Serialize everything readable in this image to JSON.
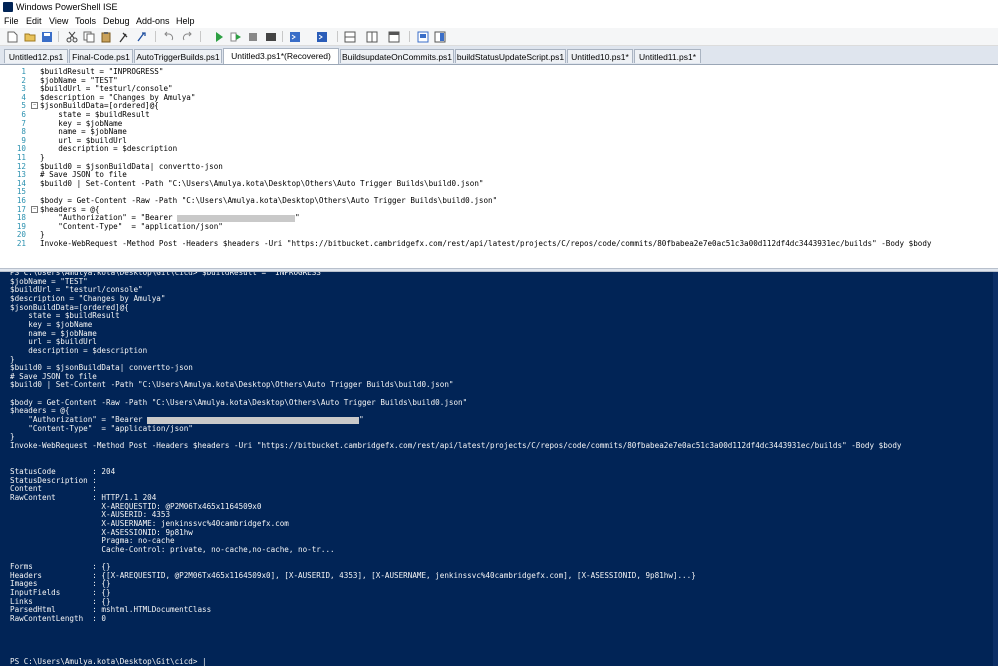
{
  "window": {
    "title": "Windows PowerShell ISE"
  },
  "menu": [
    "File",
    "Edit",
    "View",
    "Tools",
    "Debug",
    "Add-ons",
    "Help"
  ],
  "toolbar": {
    "icons": [
      "new-file-icon",
      "open-icon",
      "save-icon",
      "cut-icon",
      "copy-icon",
      "paste-icon",
      "clear-icon",
      "undo-icon",
      "redo-icon",
      "run-icon",
      "run-selection-icon",
      "stop-icon",
      "new-remote-tab-icon",
      "start-powershell-icon",
      "show-script-pane-top-icon",
      "show-script-pane-right-icon",
      "show-script-pane-maximized-icon",
      "show-command-window-icon",
      "show-command-addon-icon"
    ]
  },
  "tabs": [
    "Untitled12.ps1",
    "Final-Code.ps1",
    "AutoTriggerBuilds.ps1",
    "Untitled3.ps1*(Recovered)",
    "BuildsupdateOnCommits.ps1",
    "buildStatusUpdateScript.ps1",
    "Untitled10.ps1*",
    "Untitled11.ps1*"
  ],
  "active_tab": "Untitled3.ps1*(Recovered)",
  "editor": {
    "lines": [
      {
        "n": "1",
        "text": "$buildResult = \"INPROGRESS\""
      },
      {
        "n": "2",
        "text": "$jobName = \"TEST\""
      },
      {
        "n": "3",
        "text": "$buildUrl = \"testurl/console\""
      },
      {
        "n": "4",
        "text": "$description = \"Changes by Amulya\""
      },
      {
        "n": "5",
        "text": "$jsonBuildData=[ordered]@{"
      },
      {
        "n": "6",
        "text": "    state = $buildResult"
      },
      {
        "n": "7",
        "text": "    key = $jobName"
      },
      {
        "n": "8",
        "text": "    name = $jobName"
      },
      {
        "n": "9",
        "text": "    url = $buildUrl"
      },
      {
        "n": "10",
        "text": "    description = $description"
      },
      {
        "n": "11",
        "text": "}"
      },
      {
        "n": "12",
        "text": "$build0 = $jsonBuildData| convertto-json"
      },
      {
        "n": "13",
        "text": "# Save JSON to file"
      },
      {
        "n": "14",
        "text": "$build0 | Set-Content -Path \"C:\\Users\\Amulya.kota\\Desktop\\Others\\Auto Trigger Builds\\build0.json\""
      },
      {
        "n": "15",
        "text": ""
      },
      {
        "n": "16",
        "text": "$body = Get-Content -Raw -Path \"C:\\Users\\Amulya.kota\\Desktop\\Others\\Auto Trigger Builds\\build0.json\""
      },
      {
        "n": "17",
        "text": "$headers = @{"
      },
      {
        "n": "18",
        "text": "    \"Authorization\" = \"Bearer ",
        "redact": true,
        "tail": "\""
      },
      {
        "n": "19",
        "text": "    \"Content-Type\"  = \"application/json\""
      },
      {
        "n": "20",
        "text": "}"
      },
      {
        "n": "21",
        "text": "Invoke-WebRequest -Method Post -Headers $headers -Uri \"https://bitbucket.cambridgefx.com/rest/api/latest/projects/C/repos/code/commits/80fbabea2e7e0ac51c3a00d112df4dc3443931ec/builds\" -Body $body"
      }
    ]
  },
  "console": {
    "lines": [
      {
        "text": "PS C:\\Users\\Amulya.kota\\Desktop\\Git\\cicd> $buildResult = \"INPROGRESS\""
      },
      {
        "text": "$jobName = \"TEST\""
      },
      {
        "text": "$buildUrl = \"testurl/console\""
      },
      {
        "text": "$description = \"Changes by Amulya\""
      },
      {
        "text": "$jsonBuildData=[ordered]@{"
      },
      {
        "text": "    state = $buildResult"
      },
      {
        "text": "    key = $jobName"
      },
      {
        "text": "    name = $jobName"
      },
      {
        "text": "    url = $buildUrl"
      },
      {
        "text": "    description = $description"
      },
      {
        "text": "}"
      },
      {
        "text": "$build0 = $jsonBuildData| convertto-json"
      },
      {
        "text": "# Save JSON to file"
      },
      {
        "text": "$build0 | Set-Content -Path \"C:\\Users\\Amulya.kota\\Desktop\\Others\\Auto Trigger Builds\\build0.json\""
      },
      {
        "text": ""
      },
      {
        "text": "$body = Get-Content -Raw -Path \"C:\\Users\\Amulya.kota\\Desktop\\Others\\Auto Trigger Builds\\build0.json\""
      },
      {
        "text": "$headers = @{"
      },
      {
        "text": "    \"Authorization\" = \"Bearer ",
        "redact": true,
        "tail": "\""
      },
      {
        "text": "    \"Content-Type\"  = \"application/json\""
      },
      {
        "text": "}"
      },
      {
        "text": "Invoke-WebRequest -Method Post -Headers $headers -Uri \"https://bitbucket.cambridgefx.com/rest/api/latest/projects/C/repos/code/commits/80fbabea2e7e0ac51c3a00d112df4dc3443931ec/builds\" -Body $body"
      },
      {
        "text": ""
      },
      {
        "text": ""
      },
      {
        "text": "StatusCode        : 204"
      },
      {
        "text": "StatusDescription :"
      },
      {
        "text": "Content           :"
      },
      {
        "text": "RawContent        : HTTP/1.1 204"
      },
      {
        "text": "                    X-AREQUESTID: @P2M06Tx465x1164509x0"
      },
      {
        "text": "                    X-AUSERID: 4353"
      },
      {
        "text": "                    X-AUSERNAME: jenkinssvc%40cambridgefx.com"
      },
      {
        "text": "                    X-ASESSIONID: 9p81hw"
      },
      {
        "text": "                    Pragma: no-cache"
      },
      {
        "text": "                    Cache-Control: private, no-cache,no-cache, no-tr..."
      },
      {
        "text": ""
      },
      {
        "text": "Forms             : {}"
      },
      {
        "text": "Headers           : {[X-AREQUESTID, @P2M06Tx465x1164509x0], [X-AUSERID, 4353], [X-AUSERNAME, jenkinssvc%40cambridgefx.com], [X-ASESSIONID, 9p81hw]...}"
      },
      {
        "text": "Images            : {}"
      },
      {
        "text": "InputFields       : {}"
      },
      {
        "text": "Links             : {}"
      },
      {
        "text": "ParsedHtml        : mshtml.HTMLDocumentClass"
      },
      {
        "text": "RawContentLength  : 0"
      },
      {
        "text": ""
      },
      {
        "text": ""
      },
      {
        "text": ""
      },
      {
        "text": ""
      },
      {
        "text": "PS C:\\Users\\Amulya.kota\\Desktop\\Git\\cicd> |"
      }
    ]
  },
  "colors": {
    "console_bg": "#012456",
    "console_fg": "#f5f5f5",
    "line_number": "#2b91af",
    "tab_bg": "#dfe5ee"
  }
}
